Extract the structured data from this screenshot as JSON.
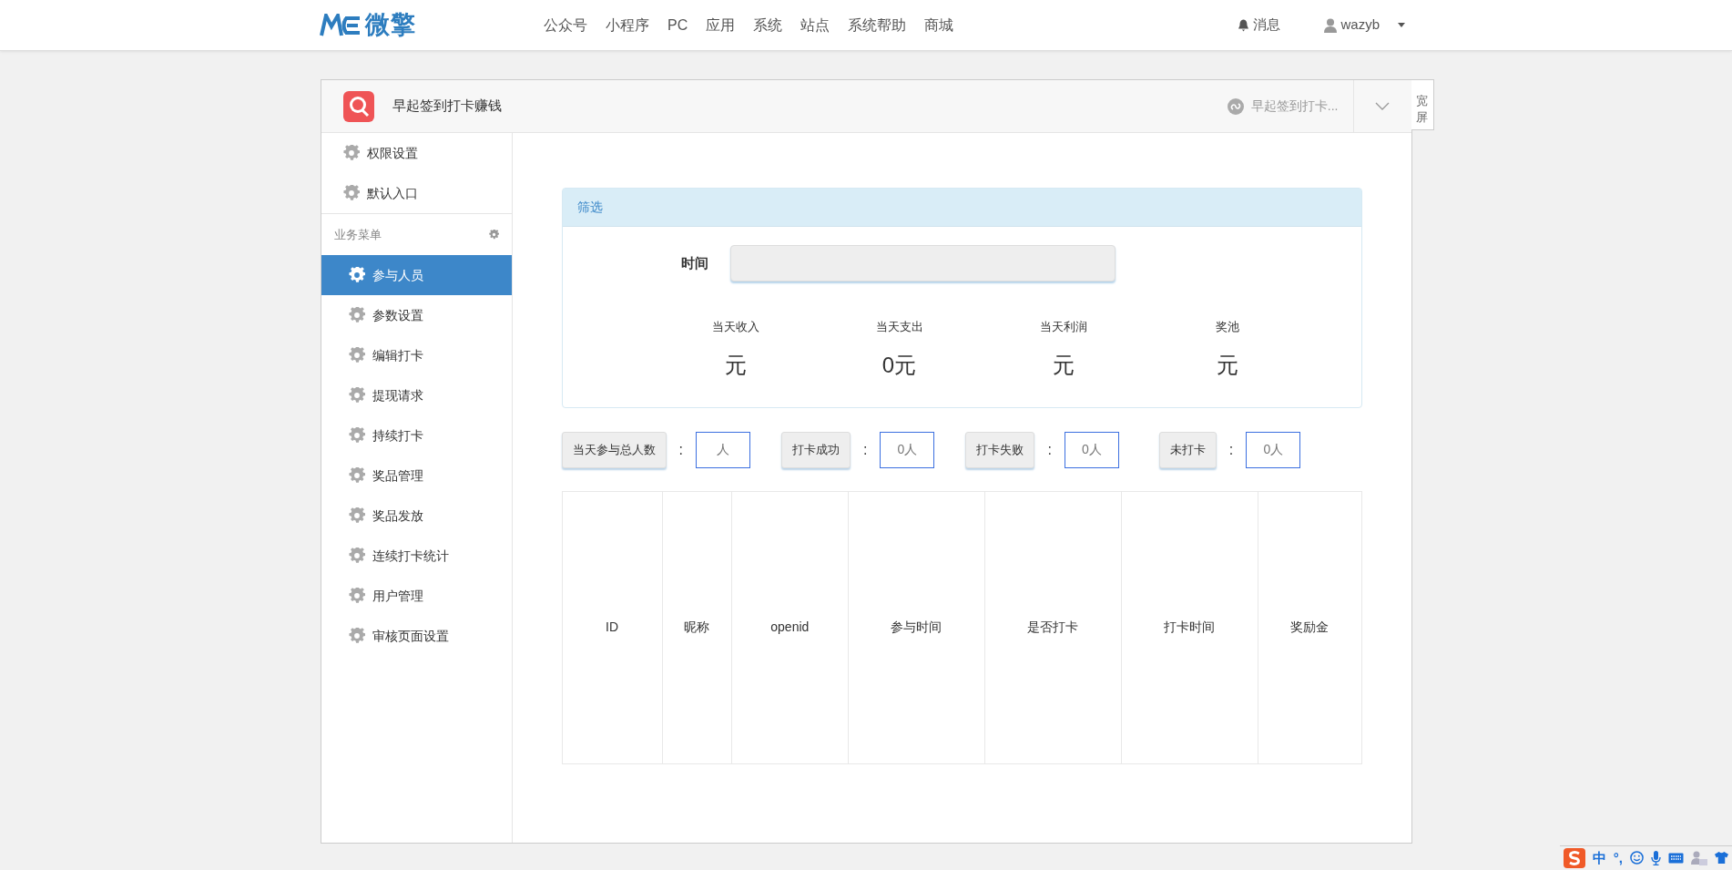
{
  "topbar": {
    "logo_text": "微擎",
    "nav": [
      {
        "label": "公众号"
      },
      {
        "label": "小程序"
      },
      {
        "label": "PC"
      },
      {
        "label": "应用"
      },
      {
        "label": "系统"
      },
      {
        "label": "站点"
      },
      {
        "label": "系统帮助"
      },
      {
        "label": "商城"
      }
    ],
    "messages": "消息",
    "user": "wazyb"
  },
  "app_header": {
    "title": "早起签到打卡赚钱",
    "mini_program": "早起签到打卡...",
    "wide_toggle": "宽屏"
  },
  "sidebar": {
    "top_items": [
      {
        "label": "权限设置"
      },
      {
        "label": "默认入口"
      }
    ],
    "section": "业务菜单",
    "items": [
      {
        "label": "参与人员",
        "selected": true
      },
      {
        "label": "参数设置",
        "selected": false
      },
      {
        "label": "编辑打卡",
        "selected": false
      },
      {
        "label": "提现请求",
        "selected": false
      },
      {
        "label": "持续打卡",
        "selected": false
      },
      {
        "label": "奖品管理",
        "selected": false
      },
      {
        "label": "奖品发放",
        "selected": false
      },
      {
        "label": "连续打卡统计",
        "selected": false
      },
      {
        "label": "用户管理",
        "selected": false
      },
      {
        "label": "审核页面设置",
        "selected": false
      }
    ]
  },
  "filter": {
    "title": "筛选",
    "time_label": "时间",
    "stats": [
      {
        "label": "当天收入",
        "value": "元"
      },
      {
        "label": "当天支出",
        "value": "0元"
      },
      {
        "label": "当天利润",
        "value": "元"
      },
      {
        "label": "奖池",
        "value": "元"
      }
    ]
  },
  "counts": [
    {
      "label": "当天参与总人数",
      "separator": ":",
      "value": "人"
    },
    {
      "label": "打卡成功",
      "separator": ":",
      "value": "0人"
    },
    {
      "label": "打卡失败",
      "separator": ":",
      "value": "0人"
    },
    {
      "label": "未打卡",
      "separator": ":",
      "value": "0人"
    }
  ],
  "table": {
    "columns": [
      "ID",
      "昵称",
      "openid",
      "参与时间",
      "是否打卡",
      "打卡时间",
      "奖励金"
    ]
  },
  "ime_bar": {
    "mode": "中",
    "punct": "°,"
  }
}
